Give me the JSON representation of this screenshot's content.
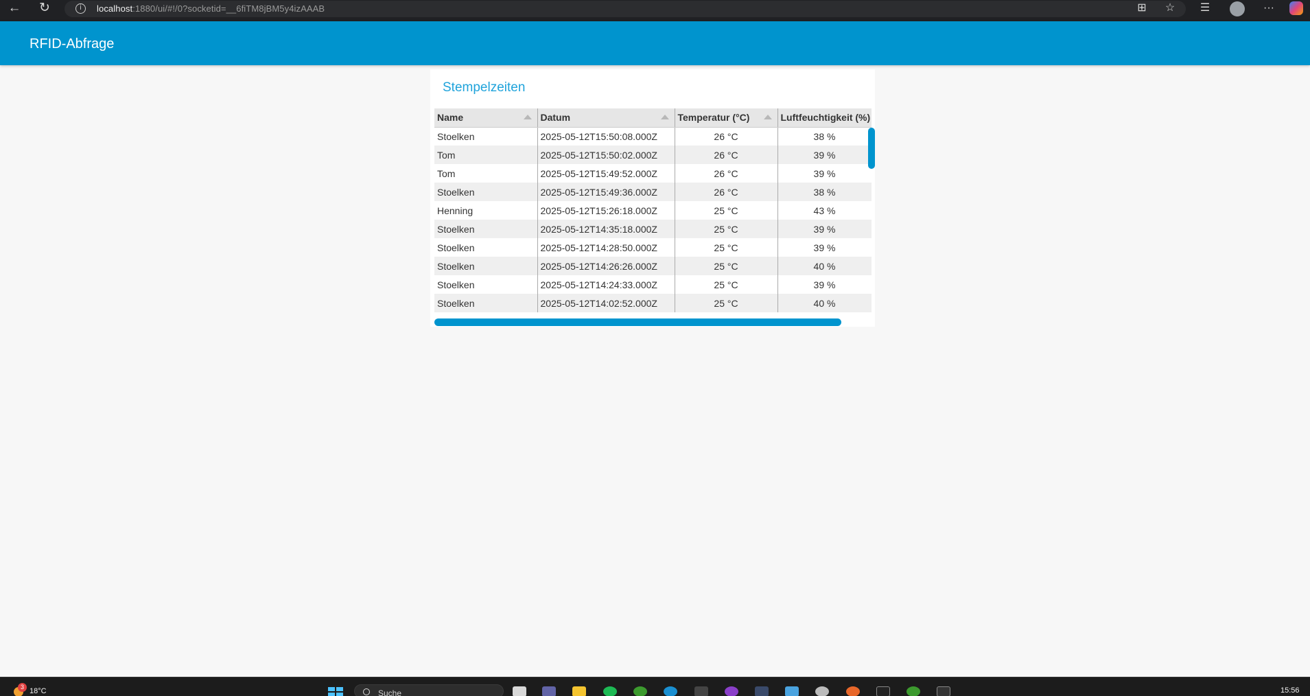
{
  "browser": {
    "url_host": "localhost",
    "url_rest": ":1880/ui/#!/0?socketid=__6fiTM8jBM5y4izAAAB"
  },
  "dashboard": {
    "title": "RFID-Abfrage",
    "accent_color": "#0094ce"
  },
  "card": {
    "title": "Stempelzeiten",
    "table": {
      "columns": [
        "Name",
        "Datum",
        "Temperatur (°C)",
        "Luftfeuchtigkeit (%)"
      ],
      "rows": [
        {
          "name": "Stoelken",
          "datum": "2025-05-12T15:50:08.000Z",
          "temp": "26 °C",
          "hum": "38 %"
        },
        {
          "name": "Tom",
          "datum": "2025-05-12T15:50:02.000Z",
          "temp": "26 °C",
          "hum": "39 %"
        },
        {
          "name": "Tom",
          "datum": "2025-05-12T15:49:52.000Z",
          "temp": "26 °C",
          "hum": "39 %"
        },
        {
          "name": "Stoelken",
          "datum": "2025-05-12T15:49:36.000Z",
          "temp": "26 °C",
          "hum": "38 %"
        },
        {
          "name": "Henning",
          "datum": "2025-05-12T15:26:18.000Z",
          "temp": "25 °C",
          "hum": "43 %"
        },
        {
          "name": "Stoelken",
          "datum": "2025-05-12T14:35:18.000Z",
          "temp": "25 °C",
          "hum": "39 %"
        },
        {
          "name": "Stoelken",
          "datum": "2025-05-12T14:28:50.000Z",
          "temp": "25 °C",
          "hum": "39 %"
        },
        {
          "name": "Stoelken",
          "datum": "2025-05-12T14:26:26.000Z",
          "temp": "25 °C",
          "hum": "40 %"
        },
        {
          "name": "Stoelken",
          "datum": "2025-05-12T14:24:33.000Z",
          "temp": "25 °C",
          "hum": "39 %"
        },
        {
          "name": "Stoelken",
          "datum": "2025-05-12T14:02:52.000Z",
          "temp": "25 °C",
          "hum": "40 %"
        }
      ]
    }
  },
  "taskbar": {
    "weather_badge": "3",
    "temperature": "18°C",
    "search_placeholder": "Suche",
    "clock": "15:56",
    "icons": [
      "file-explorer-icon",
      "teams-icon",
      "folder-icon",
      "xbox-icon",
      "node-red-icon",
      "edge-icon",
      "text-icon",
      "podcast-icon",
      "network-icon",
      "notepad-icon",
      "settings-icon",
      "git-icon",
      "terminal-icon",
      "node-red-icon-2",
      "cmd-icon"
    ]
  }
}
